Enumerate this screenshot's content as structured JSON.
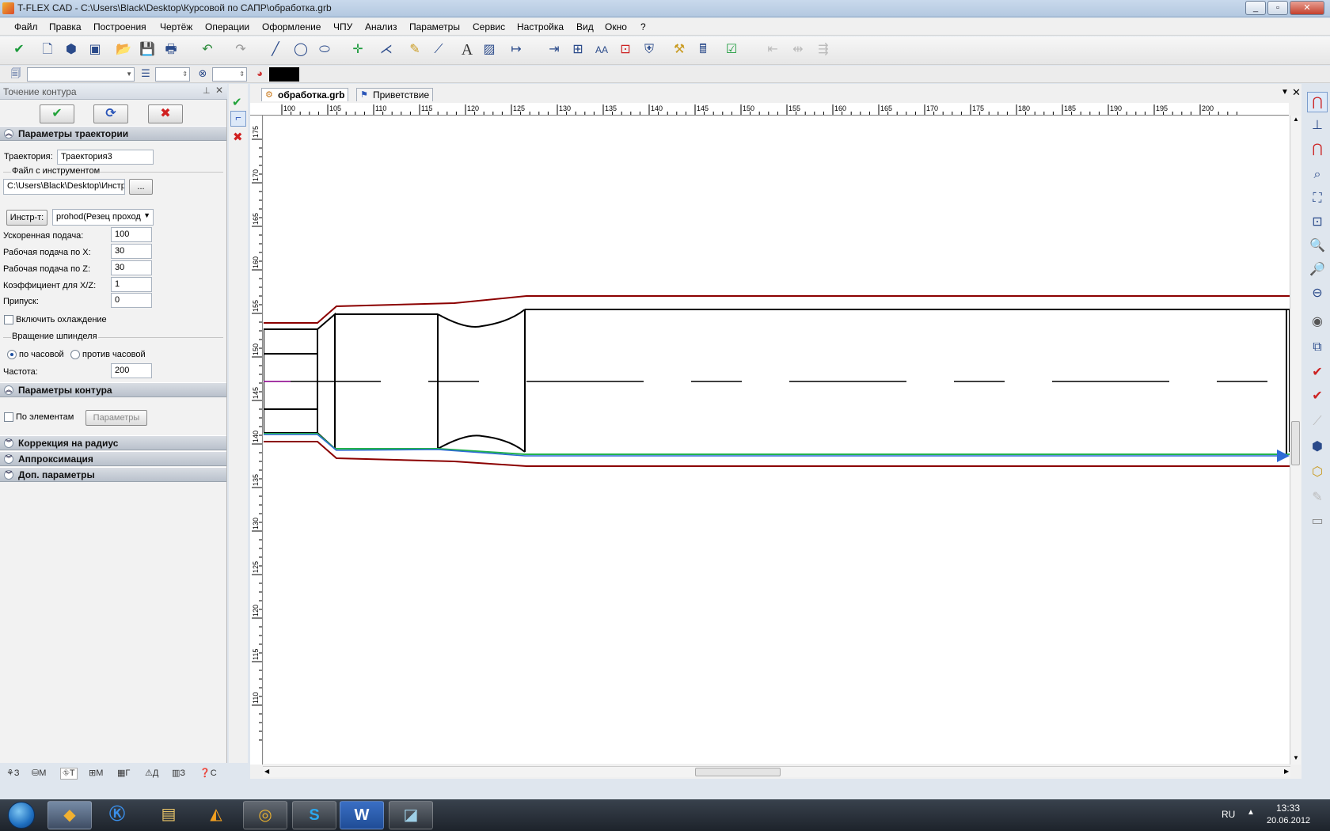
{
  "window": {
    "title": "T-FLEX CAD - C:\\Users\\Black\\Desktop\\Курсовой по САПР\\обработка.grb"
  },
  "menu": [
    "Файл",
    "Правка",
    "Построения",
    "Чертёж",
    "Операции",
    "Оформление",
    "ЧПУ",
    "Анализ",
    "Параметры",
    "Сервис",
    "Настройка",
    "Вид",
    "Окно",
    "?"
  ],
  "panel": {
    "title": "Точение контура",
    "sections": {
      "trajectory": "Параметры траектории",
      "contour": "Параметры контура",
      "radius": "Коррекция на радиус",
      "approx": "Аппроксимация",
      "extra": "Доп. параметры"
    },
    "trajectory_label": "Траектория:",
    "trajectory_value": "Траектория3",
    "tool_file_group": "Файл с инструментом",
    "tool_file_value": "C:\\Users\\Black\\Desktop\\Инстр",
    "browse_label": "...",
    "tool_button": "Инстр-т:",
    "tool_select": "prohod(Резец проход",
    "fields": [
      {
        "label": "Ускоренная подача:",
        "value": "100"
      },
      {
        "label": "Рабочая подача по X:",
        "value": "30"
      },
      {
        "label": "Рабочая подача по Z:",
        "value": "30"
      },
      {
        "label": "Коэффициент для X/Z:",
        "value": "1"
      },
      {
        "label": "Припуск:",
        "value": "0"
      }
    ],
    "cooling_label": "Включить охлаждение",
    "spindle_group": "Вращение шпинделя",
    "clockwise": "по часовой",
    "counterclockwise": "против часовой",
    "frequency_label": "Частота:",
    "frequency_value": "200",
    "by_elements": "По элементам",
    "params_button": "Параметры",
    "bottom_tabs": [
      "З",
      "М",
      "Т",
      "М",
      "Г",
      "Д",
      "З",
      "С"
    ]
  },
  "doc_tabs": [
    "обработка.grb",
    "Приветствие"
  ],
  "ruler": {
    "top": [
      "100",
      "105",
      "110",
      "115",
      "120",
      "125",
      "130",
      "135",
      "140",
      "145",
      "150",
      "155",
      "160",
      "165",
      "170",
      "175",
      "180",
      "185",
      "190",
      "195",
      "200"
    ],
    "left": [
      "175",
      "170",
      "165",
      "160",
      "155",
      "150",
      "145",
      "140",
      "135",
      "130",
      "125",
      "120",
      "115",
      "110"
    ]
  },
  "colors": {
    "blank_outline": "#8b0000",
    "part_outline": "#000000",
    "toolpath": "#2e6bd6",
    "toolpath_green": "#22b14c"
  },
  "taskbar": {
    "lang": "RU",
    "time": "13:33",
    "date": "20.06.2012",
    "apps": [
      "t-flex-icon",
      "kompas-icon",
      "folder-icon",
      "avast-icon",
      "chrome-icon",
      "skype-icon",
      "word-icon",
      "notes-icon"
    ]
  }
}
